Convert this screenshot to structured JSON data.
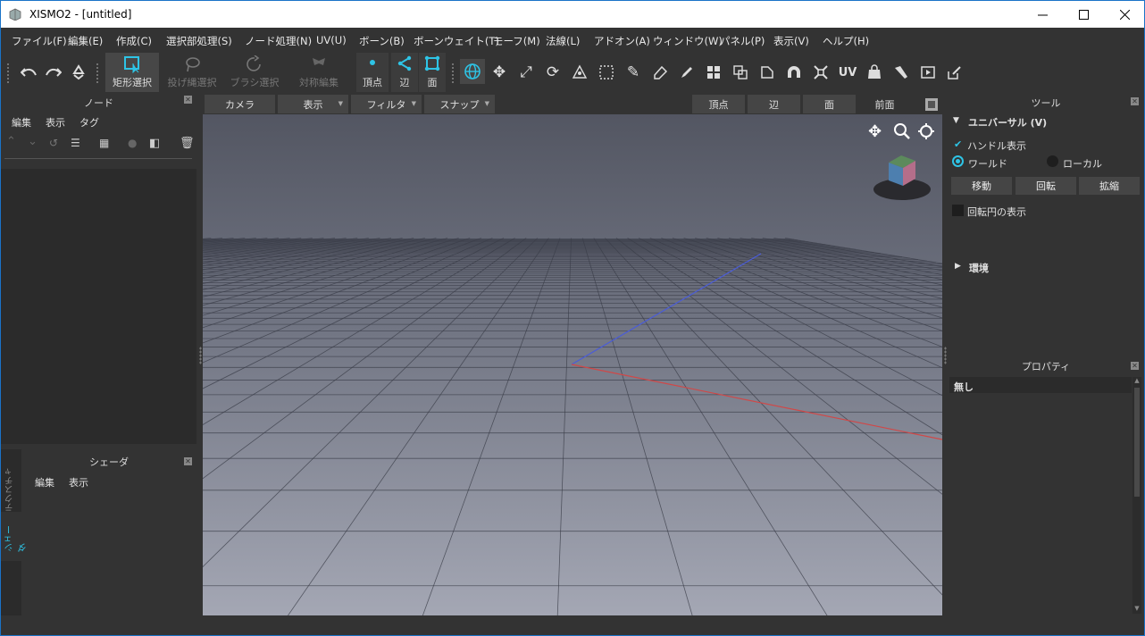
{
  "window": {
    "title": "XISMO2 - [untitled]",
    "minimize_icon": "minimize-icon",
    "maximize_icon": "maximize-icon",
    "close_icon": "close-icon"
  },
  "menu": [
    "ファイル(F)",
    "編集(E)",
    "作成(C)",
    "選択部処理(S)",
    "ノード処理(N)",
    "UV(U)",
    "ボーン(B)",
    "ボーンウェイト(T)",
    "モーフ(M)",
    "法線(L)",
    "アドオン(A)",
    "ウィンドウ(W)",
    "パネル(P)",
    "表示(V)",
    "ヘルプ(H)"
  ],
  "toolbar": {
    "rect_select": "矩形選択",
    "lasso_select": "投げ縄選択",
    "brush_select": "ブラシ選択",
    "symmetric_edit": "対称編集",
    "vertex": "頂点",
    "edge": "辺",
    "face": "面"
  },
  "node_panel": {
    "title": "ノード",
    "menu": [
      "編集",
      "表示",
      "タグ"
    ]
  },
  "shader_panel": {
    "title": "シェーダ",
    "menu": [
      "編集",
      "表示"
    ],
    "side_tabs": [
      "テクスチャ",
      "シェーダ"
    ]
  },
  "viewport": {
    "tabs": [
      "カメラ",
      "表示",
      "フィルタ",
      "スナップ"
    ],
    "mode_tabs": [
      "頂点",
      "辺",
      "面"
    ],
    "view_name": "前面"
  },
  "tool_panel": {
    "title": "ツール",
    "section_universal": "ユニバーサル (V)",
    "handle_display": "ハンドル表示",
    "handle_display_checked": true,
    "world": "ワールド",
    "local": "ローカル",
    "coordinate_selected": "ワールド",
    "buttons": [
      "移動",
      "回転",
      "拡縮"
    ],
    "show_rotation_circle": "回転円の表示",
    "show_rotation_circle_checked": false,
    "section_environment": "環境"
  },
  "property_panel": {
    "title": "プロパティ",
    "value": "無し"
  },
  "colors": {
    "accent": "#2ec4e6",
    "window_border": "#1a73c8",
    "background": "#333333"
  }
}
